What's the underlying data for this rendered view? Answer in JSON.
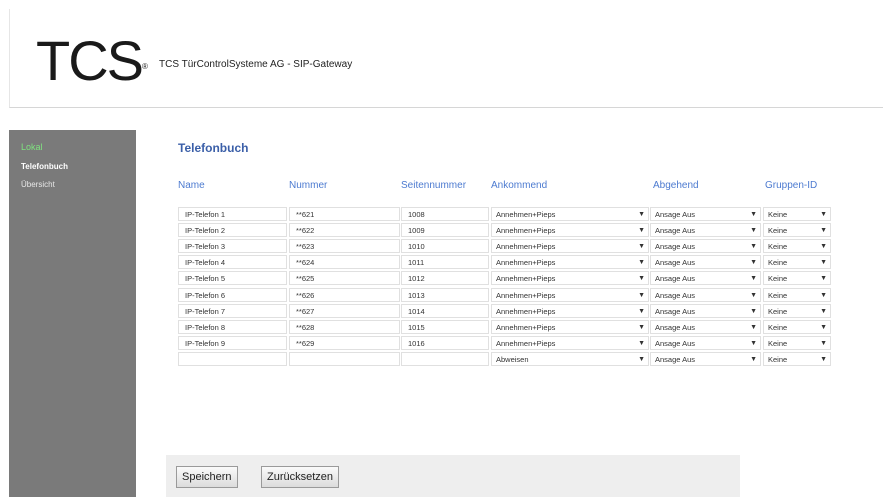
{
  "header": {
    "logo": "TCS",
    "logo_mark": "®",
    "title": "TCS TürControlSysteme AG - SIP-Gateway"
  },
  "sidebar": {
    "items": [
      {
        "label": "Lokal",
        "state": "active"
      },
      {
        "label": "Telefonbuch",
        "state": "current"
      },
      {
        "label": "Übersicht",
        "state": "normal"
      }
    ]
  },
  "page_title": "Telefonbuch",
  "columns": [
    "Name",
    "Nummer",
    "Seitennummer",
    "Ankommend",
    "Abgehend",
    "Gruppen-ID"
  ],
  "rows": [
    {
      "name": "IP-Telefon 1",
      "nummer": "**621",
      "seite": "1008",
      "ankommend": "Annehmen+Pieps",
      "abgehend": "Ansage Aus",
      "gruppe": "Keine"
    },
    {
      "name": "IP-Telefon 2",
      "nummer": "**622",
      "seite": "1009",
      "ankommend": "Annehmen+Pieps",
      "abgehend": "Ansage Aus",
      "gruppe": "Keine"
    },
    {
      "name": "IP-Telefon 3",
      "nummer": "**623",
      "seite": "1010",
      "ankommend": "Annehmen+Pieps",
      "abgehend": "Ansage Aus",
      "gruppe": "Keine"
    },
    {
      "name": "IP-Telefon 4",
      "nummer": "**624",
      "seite": "1011",
      "ankommend": "Annehmen+Pieps",
      "abgehend": "Ansage Aus",
      "gruppe": "Keine"
    },
    {
      "name": "IP-Telefon 5",
      "nummer": "**625",
      "seite": "1012",
      "ankommend": "Annehmen+Pieps",
      "abgehend": "Ansage Aus",
      "gruppe": "Keine"
    },
    {
      "name": "IP-Telefon 6",
      "nummer": "**626",
      "seite": "1013",
      "ankommend": "Annehmen+Pieps",
      "abgehend": "Ansage Aus",
      "gruppe": "Keine"
    },
    {
      "name": "IP-Telefon 7",
      "nummer": "**627",
      "seite": "1014",
      "ankommend": "Annehmen+Pieps",
      "abgehend": "Ansage Aus",
      "gruppe": "Keine"
    },
    {
      "name": "IP-Telefon 8",
      "nummer": "**628",
      "seite": "1015",
      "ankommend": "Annehmen+Pieps",
      "abgehend": "Ansage Aus",
      "gruppe": "Keine"
    },
    {
      "name": "IP-Telefon 9",
      "nummer": "**629",
      "seite": "1016",
      "ankommend": "Annehmen+Pieps",
      "abgehend": "Ansage Aus",
      "gruppe": "Keine"
    },
    {
      "name": "",
      "nummer": "",
      "seite": "",
      "ankommend": "Abweisen",
      "abgehend": "Ansage Aus",
      "gruppe": "Keine"
    }
  ],
  "buttons": {
    "save": "Speichern",
    "reset": "Zurücksetzen"
  },
  "icons": {
    "dropdown": "chevron-down-icon"
  },
  "colors": {
    "accent": "#3b5fa8",
    "header_text": "#4d7bd0",
    "sidebar_bg": "#7a7a7a",
    "active_nav": "#7fe27f"
  }
}
